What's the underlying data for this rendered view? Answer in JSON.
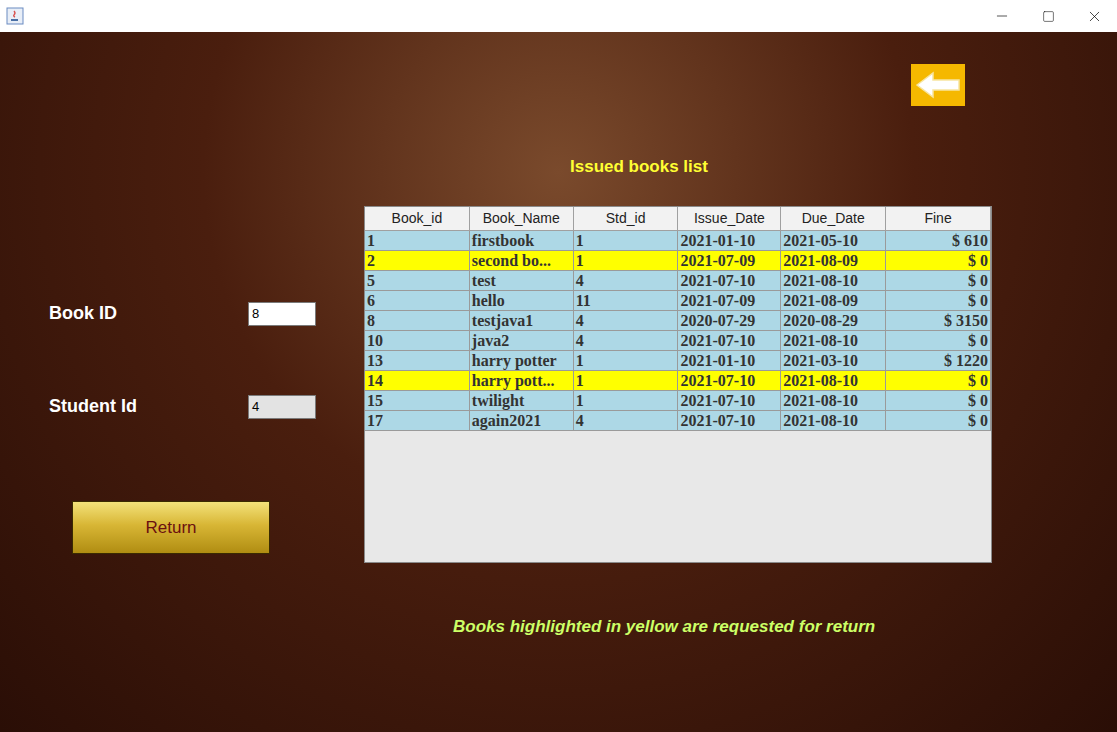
{
  "window": {
    "title": ""
  },
  "heading": "Issued books list",
  "fields": [
    {
      "label": "Book ID",
      "value": "8",
      "editable": true
    },
    {
      "label": "Student Id",
      "value": "4",
      "editable": false
    }
  ],
  "return_button": "Return",
  "table": {
    "columns": [
      "Book_id",
      "Book_Name",
      "Std_id",
      "Issue_Date",
      "Due_Date",
      "Fine"
    ],
    "rows": [
      {
        "cells": [
          "1",
          "firstbook",
          "1",
          "2021-01-10",
          "2021-05-10",
          "$ 610"
        ],
        "requested": false
      },
      {
        "cells": [
          "2",
          "second bo...",
          "1",
          "2021-07-09",
          "2021-08-09",
          "$ 0"
        ],
        "requested": true
      },
      {
        "cells": [
          "5",
          "test",
          "4",
          "2021-07-10",
          "2021-08-10",
          "$ 0"
        ],
        "requested": false
      },
      {
        "cells": [
          "6",
          "hello",
          "11",
          "2021-07-09",
          "2021-08-09",
          "$ 0"
        ],
        "requested": false
      },
      {
        "cells": [
          "8",
          "testjava1",
          "4",
          "2020-07-29",
          "2020-08-29",
          "$ 3150"
        ],
        "requested": false
      },
      {
        "cells": [
          "10",
          "java2",
          "4",
          "2021-07-10",
          "2021-08-10",
          "$ 0"
        ],
        "requested": false
      },
      {
        "cells": [
          "13",
          "harry potter",
          "1",
          "2021-01-10",
          "2021-03-10",
          "$ 1220"
        ],
        "requested": false
      },
      {
        "cells": [
          "14",
          "harry pott...",
          "1",
          "2021-07-10",
          "2021-08-10",
          "$ 0"
        ],
        "requested": true
      },
      {
        "cells": [
          "15",
          "twilight",
          "1",
          "2021-07-10",
          "2021-08-10",
          "$ 0"
        ],
        "requested": false
      },
      {
        "cells": [
          "17",
          "again2021",
          "4",
          "2021-07-10",
          "2021-08-10",
          "$ 0"
        ],
        "requested": false
      }
    ]
  },
  "note": "Books highlighted in yellow are requested for return"
}
